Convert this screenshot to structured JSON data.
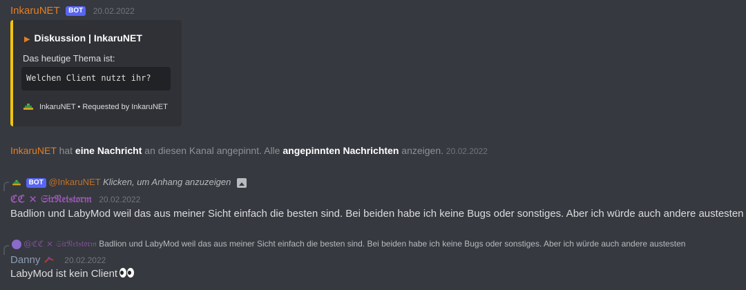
{
  "message1": {
    "author": "InkaruNET",
    "bot_tag": "BOT",
    "timestamp": "20.02.2022",
    "embed": {
      "accent_color": "#f1c40f",
      "title": "Diskussion | InkaruNET",
      "description": "Das heutige Thema ist:",
      "code": "Welchen Client nutzt ihr?",
      "footer": "InkaruNET • Requested by InkaruNET"
    }
  },
  "system_pin": {
    "name": "InkaruNET",
    "part1": "hat",
    "link1": "eine Nachricht",
    "part2": "an diesen Kanal angepinnt. Alle",
    "link2": "angepinnten Nachrichten",
    "part3": "anzeigen.",
    "timestamp": "20.02.2022"
  },
  "message2": {
    "reply": {
      "bot_tag": "BOT",
      "mention": "@InkaruNET",
      "text": "Klicken, um Anhang anzuzeigen"
    },
    "author": "ℭℭ × 𝔖𝔦𝔯𝔑𝔢𝔱𝔰𝔱𝔬𝔯𝔪",
    "timestamp": "20.02.2022",
    "text": "Badlion und LabyMod weil das aus meiner Sicht einfach die besten sind. Bei beiden habe ich keine Bugs oder sonstiges. Aber ich würde auch andere austesten"
  },
  "message3": {
    "reply": {
      "mention": "@ℭℭ × 𝔖𝔦𝔯𝔑𝔢𝔱𝔰𝔱𝔬𝔯𝔪",
      "text": "Badlion und LabyMod weil das aus meiner Sicht einfach die besten sind. Bei beiden habe ich keine Bugs oder sonstiges. Aber ich würde auch andere austesten"
    },
    "author": "Danny",
    "timestamp": "20.02.2022",
    "text": "LabyMod ist kein Client"
  },
  "colors": {
    "background": "#36393f",
    "inkaru_name": "#e67e22",
    "cc_name": "#9b59b6",
    "danny_name": "#8e9eb3",
    "bot_tag": "#5865f2"
  },
  "icons": [
    "play-arrow-icon",
    "embed-footer-island-icon",
    "image-attachment-icon",
    "smile-emoji-icon",
    "eyes-emoji-icon"
  ]
}
